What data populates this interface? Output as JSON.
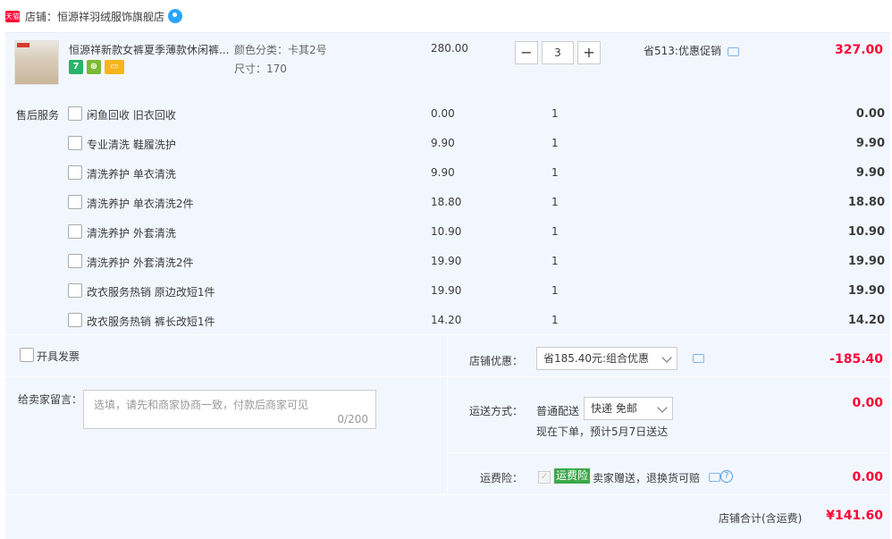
{
  "shop": {
    "logo_text": "天猫",
    "label": "店铺：恒源祥羽绒服饰旗舰店"
  },
  "item": {
    "title": "恒源祥新款女裤夏季薄款休闲裤...",
    "sku_color": "颜色分类：卡其2号",
    "sku_size": "尺寸：170",
    "unit_price": "280.00",
    "quantity": "3",
    "minus": "−",
    "plus": "+",
    "promo": "省513:优惠促销",
    "total": "327.00",
    "badge_7": "7"
  },
  "services": {
    "label": "售后服务",
    "rows": [
      {
        "name": "闲鱼回收 旧衣回收",
        "price": "0.00",
        "qty": "1",
        "total": "0.00"
      },
      {
        "name": "专业清洗 鞋履洗护",
        "price": "9.90",
        "qty": "1",
        "total": "9.90"
      },
      {
        "name": "清洗养护 单衣清洗",
        "price": "9.90",
        "qty": "1",
        "total": "9.90"
      },
      {
        "name": "清洗养护 单衣清洗2件",
        "price": "18.80",
        "qty": "1",
        "total": "18.80"
      },
      {
        "name": "清洗养护 外套清洗",
        "price": "10.90",
        "qty": "1",
        "total": "10.90"
      },
      {
        "name": "清洗养护 外套清洗2件",
        "price": "19.90",
        "qty": "1",
        "total": "19.90"
      },
      {
        "name": "改衣服务热销 原边改短1件",
        "price": "19.90",
        "qty": "1",
        "total": "19.90"
      },
      {
        "name": "改衣服务热销 裤长改短1件",
        "price": "14.20",
        "qty": "1",
        "total": "14.20"
      }
    ]
  },
  "invoice": {
    "label": "开具发票"
  },
  "message": {
    "label": "给卖家留言：",
    "placeholder": "选填，请先和商家协商一致，付款后商家可见",
    "count": "0/200"
  },
  "discount": {
    "label": "店铺优惠：",
    "selected": "省185.40元:组合优惠",
    "amount": "-185.40"
  },
  "shipping": {
    "label": "运送方式：",
    "method": "普通配送",
    "selected": "快递 免邮",
    "eta": "现在下单，预计5月7日送达",
    "amount": "0.00"
  },
  "insurance": {
    "label": "运费险：",
    "tag": "运费险",
    "text": "卖家赠送，退换货可赔",
    "amount": "0.00",
    "check": "✓",
    "help": "?"
  },
  "summary": {
    "label": "店铺合计(含运费)",
    "amount": "¥141.60"
  }
}
